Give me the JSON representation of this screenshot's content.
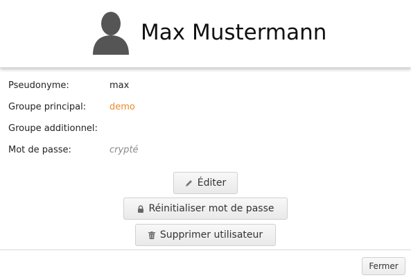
{
  "user": {
    "name": "Max Mustermann"
  },
  "details": [
    {
      "label": "Pseudonyme:",
      "value": "max"
    },
    {
      "label": "Groupe principal:",
      "value": "demo"
    },
    {
      "label": "Groupe additionnel:",
      "value": ""
    },
    {
      "label": "Mot de passe:",
      "value": "crypté"
    }
  ],
  "actions": {
    "edit_label": "Éditer",
    "reset_password_label": "Réinitialiser mot de passe",
    "delete_user_label": "Supprimer utilisateur"
  },
  "footer": {
    "close_label": "Fermer"
  },
  "icons": {
    "avatar": "user-silhouette-icon",
    "edit": "pencil-icon",
    "reset_password": "lock-icon",
    "delete": "trash-icon"
  },
  "colors": {
    "link": "#e8892b",
    "muted": "#888888",
    "avatar": "#555555"
  }
}
